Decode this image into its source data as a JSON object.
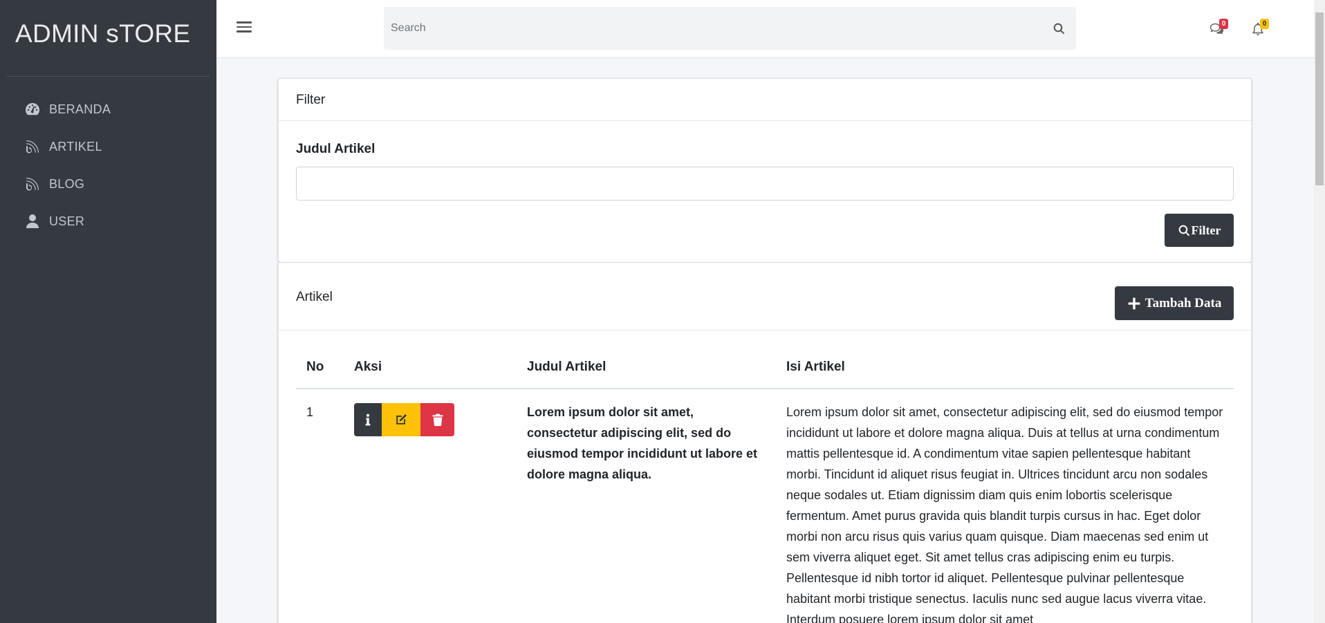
{
  "brand": {
    "title": "ADMIN sTORE"
  },
  "sidebar": {
    "items": [
      {
        "label": "BERANDA",
        "icon": "tachometer-icon"
      },
      {
        "label": "ARTIKEL",
        "icon": "blog-icon"
      },
      {
        "label": "BLOG",
        "icon": "blog-icon"
      },
      {
        "label": "USER",
        "icon": "user-icon"
      }
    ]
  },
  "topbar": {
    "search_placeholder": "Search",
    "messages_count": "0",
    "notifications_count": "0"
  },
  "filter": {
    "header": "Filter",
    "field_label": "Judul Artikel",
    "field_value": "",
    "button_label": "Filter"
  },
  "artikel": {
    "header": "Artikel",
    "add_button_label": "Tambah Data",
    "columns": [
      "No",
      "Aksi",
      "Judul Artikel",
      "Isi Artikel"
    ],
    "rows": [
      {
        "no": "1",
        "judul": "Lorem ipsum dolor sit amet, consectetur adipiscing elit, sed do eiusmod tempor incididunt ut labore et dolore magna aliqua.",
        "isi": "Lorem ipsum dolor sit amet, consectetur adipiscing elit, sed do eiusmod tempor incididunt ut labore et dolore magna aliqua. Duis at tellus at urna condimentum mattis pellentesque id. A condimentum vitae sapien pellentesque habitant morbi. Tincidunt id aliquet risus feugiat in. Ultrices tincidunt arcu non sodales neque sodales ut. Etiam dignissim diam quis enim lobortis scelerisque fermentum. Amet purus gravida quis blandit turpis cursus in hac. Eget dolor morbi non arcu risus quis varius quam quisque. Diam maecenas sed enim ut sem viverra aliquet eget. Sit amet tellus cras adipiscing enim eu turpis. Pellentesque id nibh tortor id aliquet. Pellentesque pulvinar pellentesque habitant morbi tristique senectus. Iaculis nunc sed augue lacus viverra vitae. Interdum posuere lorem ipsum dolor sit amet"
      }
    ]
  },
  "colors": {
    "sidebar_bg": "#343a40",
    "danger": "#dc3545",
    "warning": "#ffc107",
    "dark": "#343a40"
  }
}
